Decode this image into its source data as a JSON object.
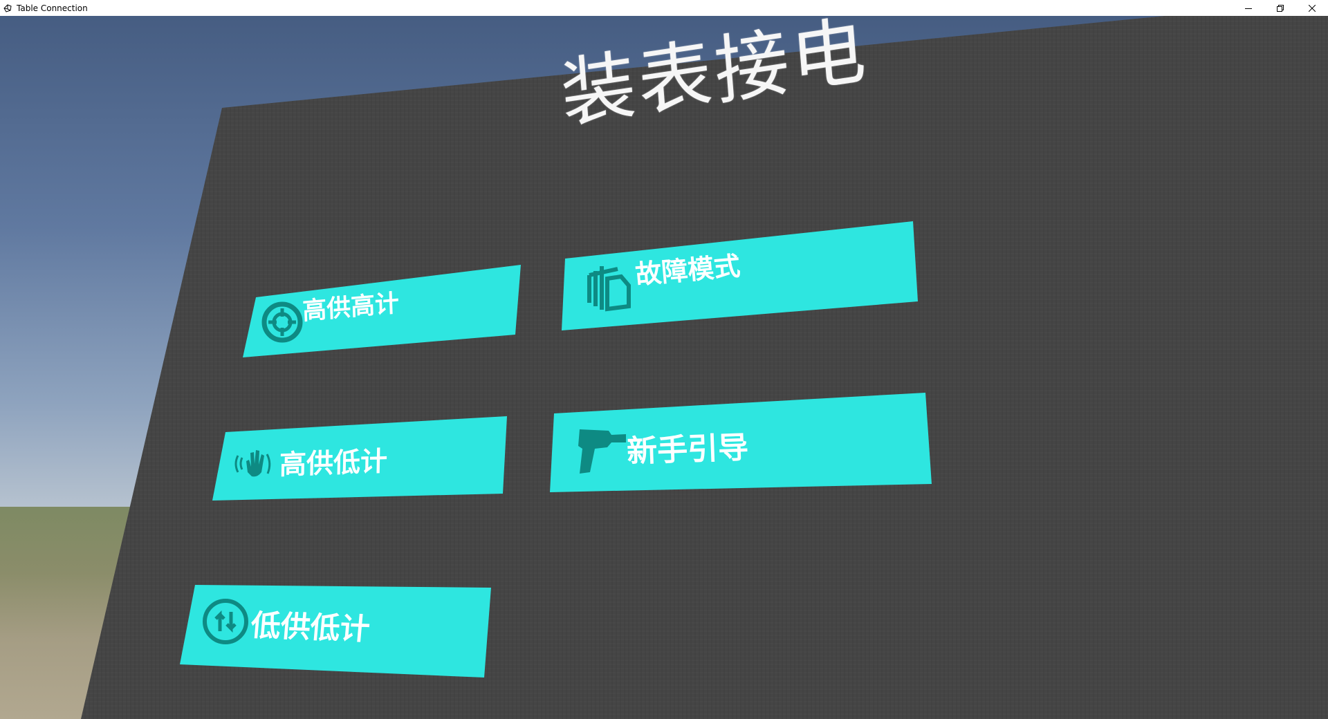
{
  "window": {
    "title": "Table Connection",
    "controls": {
      "minimize": "minimize-icon",
      "restore": "restore-icon",
      "close": "close-icon"
    }
  },
  "board": {
    "title": "装表接电",
    "buttons": [
      {
        "id": "high-high",
        "label": "高供高计",
        "icon": "crosshair-circle-icon"
      },
      {
        "id": "fault-mode",
        "label": "故障模式",
        "icon": "documents-icon"
      },
      {
        "id": "high-low",
        "label": "高供低计",
        "icon": "hand-wave-icon"
      },
      {
        "id": "novice-guide",
        "label": "新手引导",
        "icon": "drill-icon"
      },
      {
        "id": "low-low",
        "label": "低供低计",
        "icon": "refresh-arrows-icon"
      }
    ]
  },
  "colors": {
    "button_fill": "#2ee6e0",
    "icon_color": "#0e8a83",
    "panel": "#444444",
    "sky_top": "#465d82"
  }
}
